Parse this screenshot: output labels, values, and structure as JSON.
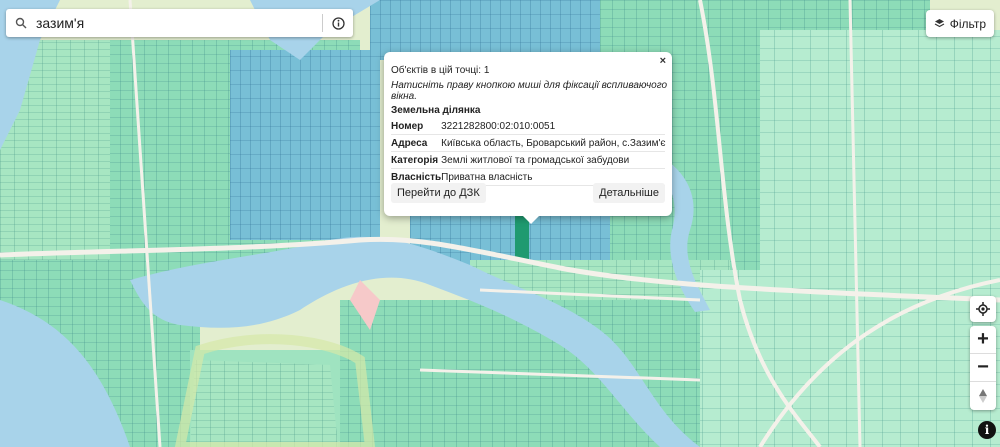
{
  "search": {
    "value": "зазим'я"
  },
  "filter": {
    "label": "Фільтр"
  },
  "popup": {
    "objects_line": "Об'єктів в цій точці: 1",
    "hint": "Натисніть праву кнопкою миші для фіксації вспливаючого вікна.",
    "title": "Земельна ділянка",
    "rows": [
      {
        "key": "Номер",
        "value": "3221282800:02:010:0051"
      },
      {
        "key": "Адреса",
        "value": "Київська область, Броварський район, с.Зазим'є"
      },
      {
        "key": "Категорія",
        "value": "Землі житлової та громадської забудови"
      },
      {
        "key": "Власність",
        "value": "Приватна власність"
      }
    ],
    "btn_dzk": "Перейти до ДЗК",
    "btn_detail": "Детальніше",
    "close": "×"
  },
  "controls": {
    "zoom_in": "+",
    "zoom_out": "−"
  },
  "map": {
    "water": "#a8d3ea",
    "parcel_green": "#9ee3bf",
    "parcel_teal": "#6cc9ae",
    "parcel_blue": "#6ea9d0",
    "road": "#f4f1ea"
  }
}
